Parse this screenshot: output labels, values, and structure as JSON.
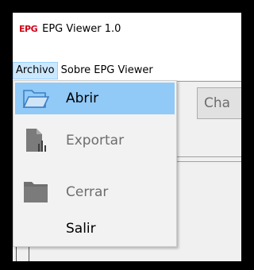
{
  "window": {
    "logo_text": "EPG",
    "title": "EPG Viewer 1.0"
  },
  "menubar": {
    "items": [
      {
        "label": "Archivo",
        "active": true
      },
      {
        "label": "Sobre EPG Viewer",
        "active": false
      }
    ]
  },
  "toolbar": {
    "partial_button_label": "Cha"
  },
  "file_menu": {
    "items": [
      {
        "label": "Abrir",
        "icon": "folder-open-icon",
        "enabled": true,
        "highlighted": true
      },
      {
        "label": "Exportar",
        "icon": "export-document-icon",
        "enabled": false,
        "highlighted": false
      },
      {
        "label": "Cerrar",
        "icon": "folder-closed-icon",
        "enabled": false,
        "highlighted": false
      },
      {
        "label": "Salir",
        "icon": "",
        "enabled": true,
        "highlighted": false
      }
    ]
  },
  "colors": {
    "highlight": "#91c9f7",
    "menu_active": "#cce8ff",
    "logo": "#d2001a",
    "disabled_text": "#6d6d6d"
  }
}
